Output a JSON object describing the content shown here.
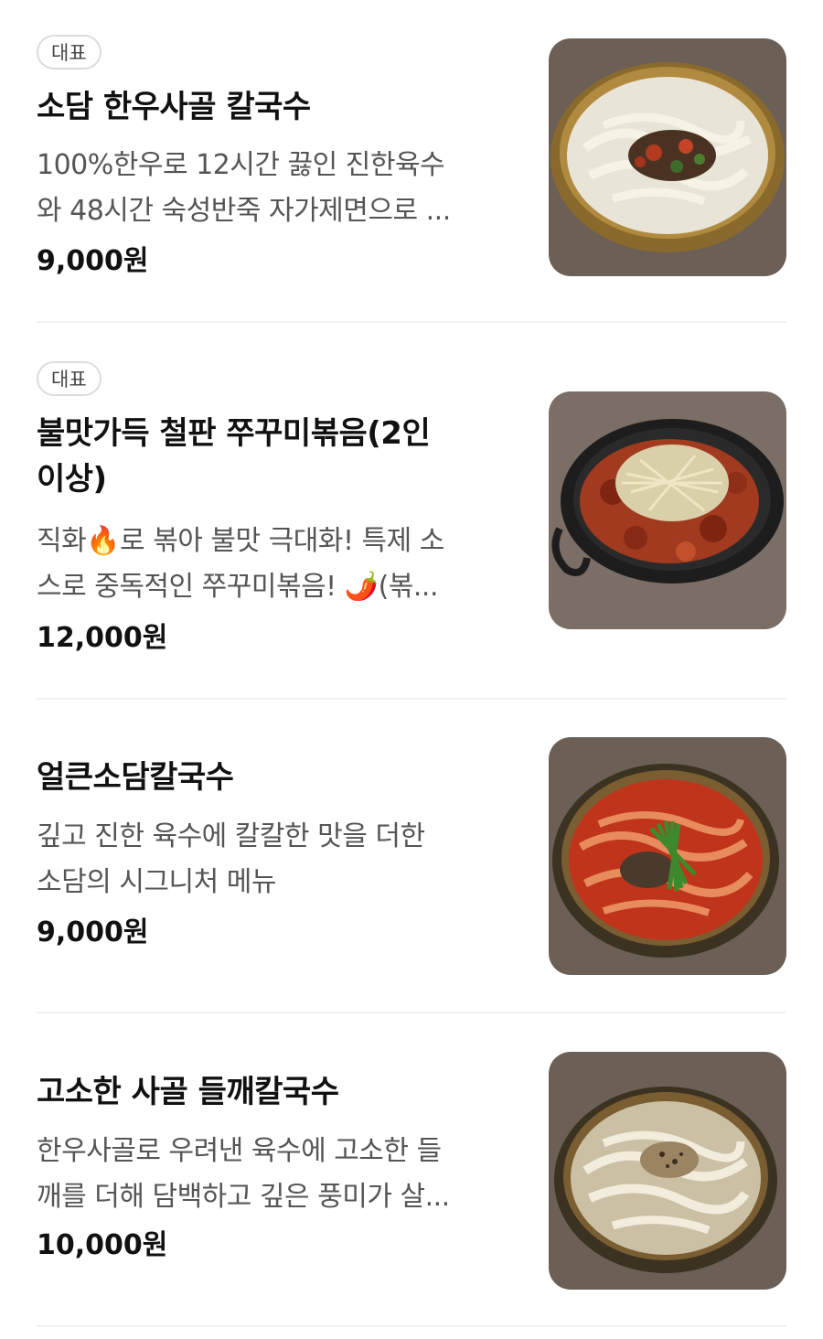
{
  "menu": {
    "items": [
      {
        "badge": "대표",
        "name": "소담 한우사골 칼국수",
        "desc_line1": "100%한우로 12시간 끓인 진한육수",
        "desc_line2": "와 48시간 숙성반죽 자가제면으로 ...",
        "price": "9,000원",
        "photo": "white-broth-kalguksu-photo"
      },
      {
        "badge": "대표",
        "name_line1": "불맛가득 철판 쭈꾸미볶음(2인",
        "name_line2": "이상)",
        "desc_line1": "직화🔥로 볶아 불맛 극대화! 특제 소",
        "desc_line2": "스로 중독적인 쭈꾸미볶음! 🌶️(볶...",
        "price": "12,000원",
        "photo": "spicy-webfoot-octopus-pan-photo"
      },
      {
        "name": "얼큰소담칼국수",
        "desc_line1": "깊고 진한 육수에 칼칼한 맛을 더한",
        "desc_line2": "소담의 시그니처 메뉴",
        "price": "9,000원",
        "photo": "spicy-red-kalguksu-photo"
      },
      {
        "name": "고소한 사골 들깨칼국수",
        "desc_line1": "한우사골로 우려낸 육수에 고소한 들",
        "desc_line2": "깨를 더해 담백하고 깊은 풍미가 살...",
        "price": "10,000원",
        "photo": "perilla-kalguksu-photo"
      }
    ]
  },
  "colors": {
    "background": "#ffffff",
    "divider": "#f0f0f0",
    "text_primary": "#111111",
    "text_secondary": "#555555",
    "badge_border": "#dcdcdc"
  }
}
